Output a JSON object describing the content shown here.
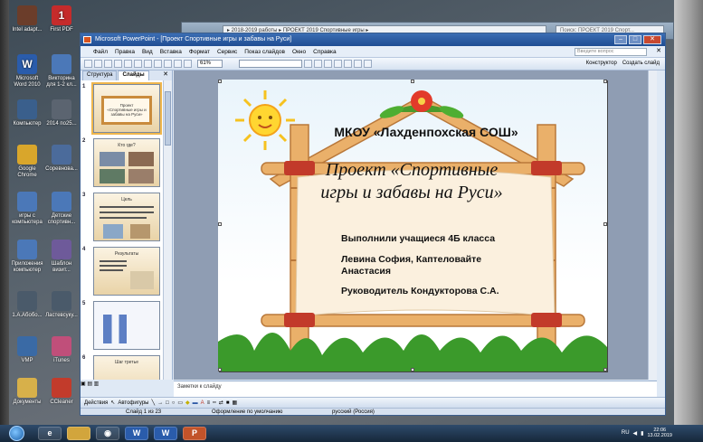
{
  "desktop": {
    "icons": [
      {
        "label": "Intel adapt...",
        "glyph": "",
        "color": "#6b3d2a"
      },
      {
        "label": "First PDF",
        "glyph": "1",
        "color": "#c52b2b"
      },
      {
        "label": "Microsoft Word 2010",
        "glyph": "W",
        "color": "#2a5cab"
      },
      {
        "label": "Викторина для 1-2 кл...",
        "glyph": "",
        "color": "#4b78b8"
      },
      {
        "label": "Компьютер",
        "glyph": "",
        "color": "#3a5f8c"
      },
      {
        "label": "2014 по25...",
        "glyph": "",
        "color": "#5b6470"
      },
      {
        "label": "Google Chrome",
        "glyph": "",
        "color": "#d9a62b"
      },
      {
        "label": "Соревнова...",
        "glyph": "",
        "color": "#4b6b9b"
      },
      {
        "label": "игры с компьютера",
        "glyph": "",
        "color": "#4b78b8"
      },
      {
        "label": "Детские спортивн...",
        "glyph": "",
        "color": "#4b78b8"
      },
      {
        "label": "Приложения компьютер",
        "glyph": "",
        "color": "#4b78b8"
      },
      {
        "label": "Шаблон визит...",
        "glyph": "",
        "color": "#6e5a9a"
      },
      {
        "label": "1.A.Aбобо...",
        "glyph": "",
        "color": "#4a5a6a"
      },
      {
        "label": "Ластевсуку...",
        "glyph": "",
        "color": "#4a5a6a"
      },
      {
        "label": "VMP",
        "glyph": "",
        "color": "#3a6aa5"
      },
      {
        "label": "iTunes",
        "glyph": "",
        "color": "#c04f7a"
      },
      {
        "label": "Документы",
        "glyph": "",
        "color": "#d7b04a"
      },
      {
        "label": "CCleaner",
        "glyph": "",
        "color": "#c23b2b"
      }
    ]
  },
  "background_window": {
    "address": "▸ 2018-2019 работы ▸ ПРОЕКТ 2019 Спортивные игры ▸",
    "search_placeholder": "Поиск: ПРОЕКТ 2019 Спорт..."
  },
  "ppt": {
    "title": "Microsoft PowerPoint - [Проект Спортивные игры и забавы на Руси]",
    "menu": [
      "Файл",
      "Правка",
      "Вид",
      "Вставка",
      "Формат",
      "Сервис",
      "Показ слайдов",
      "Окно",
      "Справка"
    ],
    "help_placeholder": "Введите вопрос",
    "zoom": "61%",
    "designer_label": "Конструктор",
    "new_slide_label": "Создать слайд",
    "pane_tabs": [
      "Структура",
      "Слайды"
    ],
    "thumbnails": [
      {
        "num": "1",
        "title": "Проект «Спортивные игры и забавы на Руси»"
      },
      {
        "num": "2",
        "title": "Кто где?"
      },
      {
        "num": "3",
        "title": "Цель"
      },
      {
        "num": "4",
        "title": "Результаты"
      },
      {
        "num": "5",
        "title": ""
      },
      {
        "num": "6",
        "title": "Шаг третье"
      }
    ],
    "notes_placeholder": "Заметки к слайду",
    "draw_toolbar": {
      "actions": "Действия",
      "autoshapes": "Автофигуры"
    },
    "status": {
      "slide": "Слайд 1 из 23",
      "design": "Оформление по умолчанию",
      "language": "русский (Россия)"
    }
  },
  "slide": {
    "school": "МКОУ «Лахденпохская СОШ»",
    "project_line1": "Проект «Спортивные",
    "project_line2": "игры и забавы на Руси»",
    "students": "Выполнили учащиеся 4Б класса",
    "names_line1": "Левина София, Каптеловайте",
    "names_line2": "Анастасия",
    "teacher": "Руководитель Кондукторова С.А."
  },
  "taskbar": {
    "language": "RU",
    "time": "22:06",
    "date": "13.02.2019"
  },
  "colors": {
    "ppt_title": "#1f4d93",
    "bamboo": "#e8a256",
    "ribbon": "#c23a2a",
    "grass": "#3b9a2b"
  }
}
